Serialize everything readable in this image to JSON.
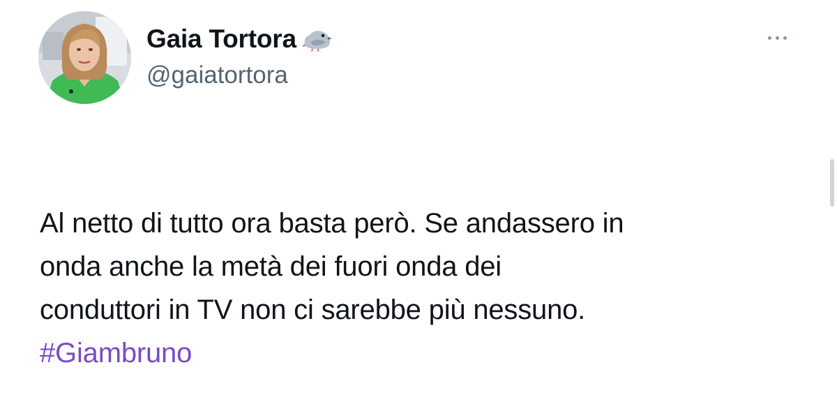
{
  "user": {
    "display_name": "Gaia Tortora",
    "handle": "@gaiatortora",
    "avatar_icon": "profile-photo",
    "badge_icon": "pigeon-emoji"
  },
  "tweet": {
    "text": "Al netto di tutto ora basta però. Se andassero in\nonda anche la metà dei fuori onda dei\nconduttori in TV non ci sarebbe più nessuno.",
    "hashtag": "#Giambruno"
  },
  "actions": {
    "more_icon": "more-options-icon"
  },
  "colors": {
    "text": "#0f1419",
    "secondary_text": "#536471",
    "hashtag": "#794bc4",
    "more_dots": "#8b98a5"
  }
}
